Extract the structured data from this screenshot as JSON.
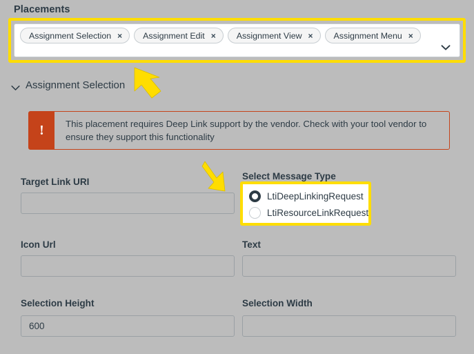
{
  "placements": {
    "label": "Placements",
    "tags": [
      {
        "label": "Assignment Selection",
        "remove": "×"
      },
      {
        "label": "Assignment Edit",
        "remove": "×"
      },
      {
        "label": "Assignment View",
        "remove": "×"
      },
      {
        "label": "Assignment Menu",
        "remove": "×"
      }
    ],
    "dropdown_icon": "chevron-down-icon"
  },
  "section": {
    "title": "Assignment Selection",
    "chevron_icon": "chevron-down-icon",
    "expanded": true
  },
  "alert": {
    "icon": "exclamation-icon",
    "icon_glyph": "!",
    "message": "This placement requires Deep Link support by the vendor. Check with your tool vendor to ensure they support this functionality",
    "accent_color": "#c5431a"
  },
  "form": {
    "target_link_uri": {
      "label": "Target Link URI",
      "value": "",
      "placeholder": ""
    },
    "icon_url": {
      "label": "Icon Url",
      "value": "",
      "placeholder": ""
    },
    "selection_height": {
      "label": "Selection Height",
      "value": "600",
      "placeholder": ""
    },
    "text": {
      "label": "Text",
      "value": "",
      "placeholder": ""
    },
    "selection_width": {
      "label": "Selection Width",
      "value": "",
      "placeholder": ""
    }
  },
  "message_type": {
    "label": "Select Message Type",
    "options": [
      {
        "label": "LtiDeepLinkingRequest",
        "selected": true
      },
      {
        "label": "LtiResourceLinkRequest",
        "selected": false
      }
    ]
  },
  "annotations": {
    "highlight_color": "#ffdd00",
    "arrow_1": "arrow-pointing-up-left-icon",
    "arrow_2": "arrow-pointing-down-right-icon"
  },
  "colors": {
    "background": "#bcbcbc",
    "text": "#2d3b45",
    "field_border": "#9aa0a4"
  }
}
